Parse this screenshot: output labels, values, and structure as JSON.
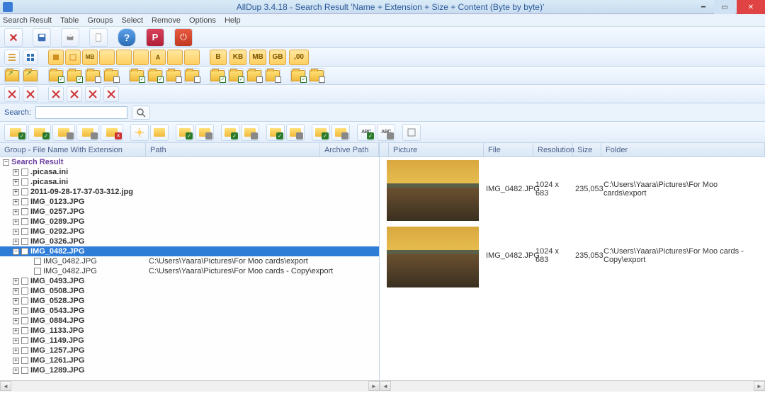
{
  "title": "AllDup 3.4.18 - Search Result 'Name + Extension + Size + Content (Byte by byte)'",
  "menu": [
    "Search Result",
    "Table",
    "Groups",
    "Select",
    "Remove",
    "Options",
    "Help"
  ],
  "units": [
    "B",
    "KB",
    "MB",
    "GB",
    ",00"
  ],
  "search_label": "Search:",
  "search_value": "",
  "left_headers": {
    "group": "Group - File Name With Extension",
    "path": "Path",
    "archive": "Archive Path"
  },
  "root_label": "Search Result",
  "groups": [
    {
      "name": ".picasa.ini",
      "expanded": false
    },
    {
      "name": ".picasa.ini",
      "expanded": false
    },
    {
      "name": "2011-09-28-17-37-03-312.jpg",
      "expanded": false
    },
    {
      "name": "IMG_0123.JPG",
      "expanded": false
    },
    {
      "name": "IMG_0257.JPG",
      "expanded": false
    },
    {
      "name": "IMG_0289.JPG",
      "expanded": false
    },
    {
      "name": "IMG_0292.JPG",
      "expanded": false
    },
    {
      "name": "IMG_0326.JPG",
      "expanded": false
    },
    {
      "name": "IMG_0482.JPG",
      "expanded": true,
      "selected": true,
      "children": [
        {
          "name": "IMG_0482.JPG",
          "path": "C:\\Users\\Yaara\\Pictures\\For Moo cards\\export"
        },
        {
          "name": "IMG_0482.JPG",
          "path": "C:\\Users\\Yaara\\Pictures\\For Moo cards - Copy\\export"
        }
      ]
    },
    {
      "name": "IMG_0493.JPG",
      "expanded": false
    },
    {
      "name": "IMG_0508.JPG",
      "expanded": false
    },
    {
      "name": "IMG_0528.JPG",
      "expanded": false
    },
    {
      "name": "IMG_0543.JPG",
      "expanded": false
    },
    {
      "name": "IMG_0884.JPG",
      "expanded": false
    },
    {
      "name": "IMG_1133.JPG",
      "expanded": false
    },
    {
      "name": "IMG_1149.JPG",
      "expanded": false
    },
    {
      "name": "IMG_1257.JPG",
      "expanded": false
    },
    {
      "name": "IMG_1261.JPG",
      "expanded": false
    },
    {
      "name": "IMG_1289.JPG",
      "expanded": false
    }
  ],
  "right_headers": {
    "picture": "Picture",
    "file": "File",
    "resolution": "Resolution",
    "size": "Size",
    "folder": "Folder"
  },
  "details": [
    {
      "file": "IMG_0482.JPG",
      "resolution": "1024 x 683",
      "size": "235,053",
      "folder": "C:\\Users\\Yaara\\Pictures\\For Moo cards\\export"
    },
    {
      "file": "IMG_0482.JPG",
      "resolution": "1024 x 683",
      "size": "235,053",
      "folder": "C:\\Users\\Yaara\\Pictures\\For Moo cards - Copy\\export"
    }
  ]
}
